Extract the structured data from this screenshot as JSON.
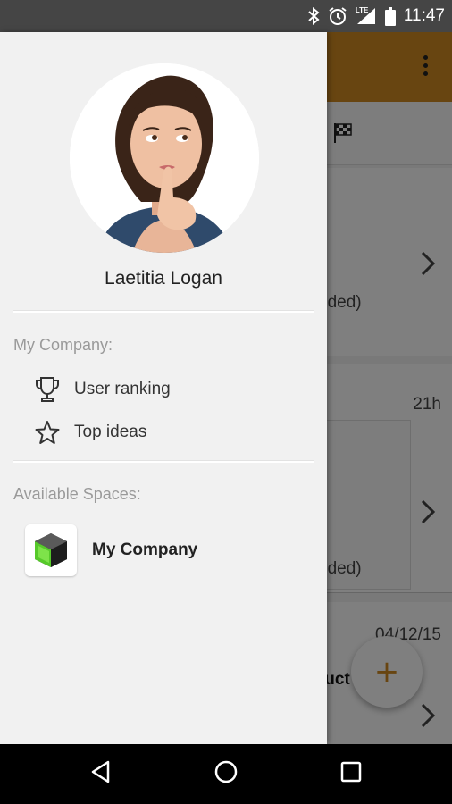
{
  "status_bar": {
    "time": "11:47",
    "network_label": "LTE",
    "icons": [
      "bluetooth-icon",
      "alarm-icon",
      "signal-icon",
      "battery-icon"
    ]
  },
  "background_screen": {
    "accent_color": "#d08a22",
    "card1_partial_text": "eded)",
    "card2_time": "21h",
    "card2_partial_text": "eded)",
    "card3_date": "04/12/15",
    "card3_partial_text": "luct",
    "fab_label": "+"
  },
  "drawer": {
    "user_name": "Laetitia Logan",
    "company_section": {
      "label": "My Company:",
      "items": [
        {
          "label": "User ranking",
          "icon": "trophy-icon"
        },
        {
          "label": "Top ideas",
          "icon": "star-icon"
        }
      ]
    },
    "spaces_section": {
      "label": "Available Spaces:",
      "items": [
        {
          "label": "My Company",
          "icon": "company-cube-logo"
        }
      ]
    }
  },
  "nav_bar": {
    "buttons": [
      "back-icon",
      "home-icon",
      "recents-icon"
    ]
  }
}
